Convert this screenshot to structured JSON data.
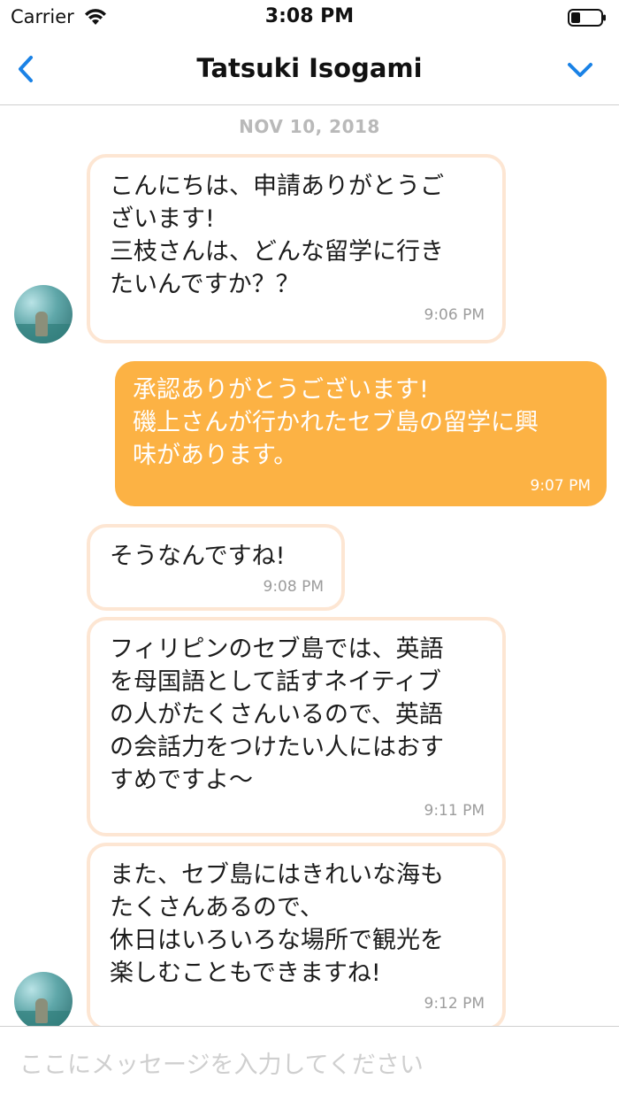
{
  "status_bar": {
    "carrier": "Carrier",
    "time": "3:08 PM"
  },
  "nav": {
    "title": "Tatsuki Isogami",
    "accent_color": "#1a82e6"
  },
  "chat": {
    "date_separator": "NOV 10, 2018",
    "messages": [
      {
        "direction": "in",
        "text": "こんにちは、申請ありがとうご\nざいます!\n三枝さんは、どんな留学に行き\nたいんですか？？",
        "time": "9:06 PM"
      },
      {
        "direction": "out",
        "text": "承認ありがとうございます!\n磯上さんが行かれたセブ島の留学に興\n味があります。",
        "time": "9:07 PM"
      },
      {
        "direction": "in",
        "text": "そうなんですね!",
        "time": "9:08 PM"
      },
      {
        "direction": "in",
        "text": "フィリピンのセブ島では、英語\nを母国語として話すネイティブ\nの人がたくさんいるので、英語\nの会話力をつけたい人にはおす\nすめですよ〜",
        "time": "9:11 PM"
      },
      {
        "direction": "in",
        "text": "また、セブ島にはきれいな海も\nたくさんあるので、\n休日はいろいろな場所で観光を\n楽しむこともできますね!",
        "time": "9:12 PM"
      }
    ],
    "colors": {
      "outgoing_bubble": "#fcb244",
      "incoming_border": "#fde6d3"
    }
  },
  "input": {
    "placeholder": "ここにメッセージを入力してください",
    "value": ""
  }
}
